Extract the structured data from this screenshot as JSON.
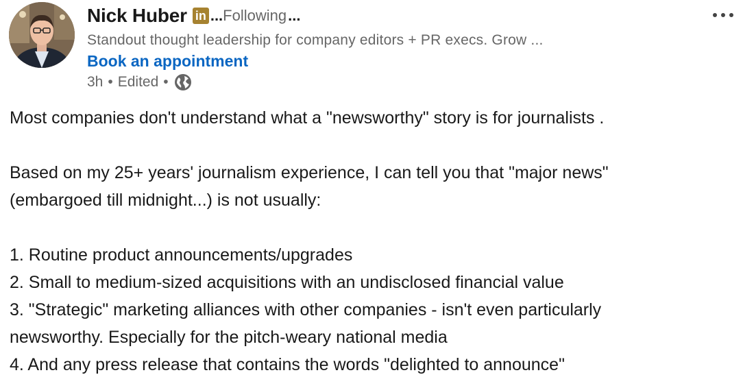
{
  "post": {
    "author": {
      "name": "Nick Huber",
      "badge_label": "in",
      "name_ellipsis": "...",
      "follow_status": "Following",
      "follow_ellipsis": "...",
      "headline": "Standout thought leadership for company editors + PR execs. Grow ...",
      "link_label": "Book an appointment",
      "time_ago": "3h",
      "separator": "•",
      "edited_label": "Edited"
    },
    "icons": {
      "more": "more-horizontal-icon",
      "visibility": "globe-icon",
      "badge": "linkedin-badge-icon"
    },
    "colors": {
      "link": "#0a66c2",
      "badge": "#a68230",
      "secondary_text": "#666666",
      "primary_text": "#191919"
    },
    "body": {
      "intro": "Most companies don't understand what a \"newsworthy\" story is for journalists .",
      "para1_line1": "Based on my 25+ years' journalism experience, I can tell you that \"major news\"",
      "para1_line2": "(embargoed till midnight...) is not usually:",
      "list": [
        "1. Routine product announcements/upgrades",
        "2. Small to medium-sized acquisitions with an undisclosed financial value",
        "3. \"Strategic\" marketing alliances with other companies - isn't even particularly",
        "newsworthy. Especially for the pitch-weary national media",
        "4. And any press release that contains the words \"delighted to announce\""
      ]
    }
  }
}
